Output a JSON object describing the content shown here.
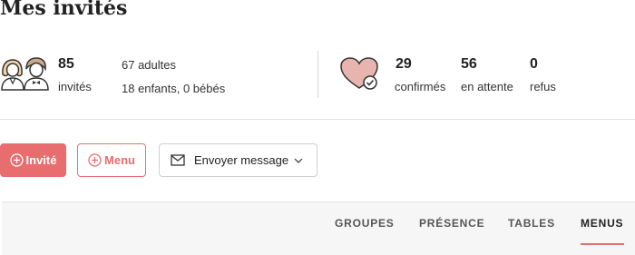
{
  "page": {
    "title": "Mes invités"
  },
  "guests_summary": {
    "total": "85",
    "total_label": "invités",
    "adults": "67 adultes",
    "children_babies": "18 enfants, 0 bébés"
  },
  "rsvp_summary": {
    "confirmed": "29",
    "confirmed_label": "confirmés",
    "pending": "56",
    "pending_label": "en attente",
    "declined": "0",
    "declined_label": "refus"
  },
  "actions": {
    "add_guest_label": "Invité",
    "add_menu_label": "Menu",
    "send_message_label": "Envoyer message"
  },
  "tabs": [
    {
      "label": "GROUPES"
    },
    {
      "label": "PRÉSENCE"
    },
    {
      "label": "TABLES"
    },
    {
      "label": "MENUS",
      "active": true
    }
  ],
  "colors": {
    "accent": "#e86d6f",
    "heart": "#e8b4b0"
  },
  "icons": [
    "couple-icon",
    "heart-check-icon",
    "plus-circle-icon",
    "mail-icon",
    "chevron-down-icon"
  ]
}
